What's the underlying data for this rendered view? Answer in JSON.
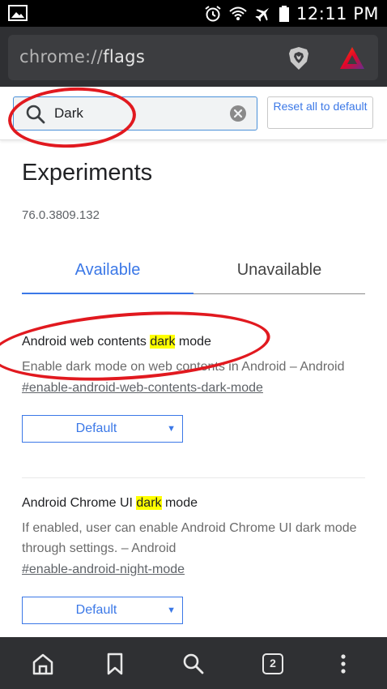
{
  "status_bar": {
    "time": "12:11 PM",
    "left_icon": "gallery-icon",
    "right_icons": [
      "alarm-icon",
      "wifi-icon",
      "airplane-icon",
      "battery-icon"
    ]
  },
  "url_bar": {
    "scheme": "chrome://",
    "path": "flags",
    "icons": [
      "brave-shield-icon",
      "bat-rewards-icon"
    ]
  },
  "search": {
    "value": "Dark",
    "reset_label": "Reset all to default"
  },
  "header": {
    "title": "Experiments",
    "version": "76.0.3809.132"
  },
  "tabs": [
    {
      "label": "Available",
      "active": true
    },
    {
      "label": "Unavailable",
      "active": false
    }
  ],
  "experiments": [
    {
      "title_before": "Android web contents ",
      "title_highlight": "dark",
      "title_after": " mode",
      "description": "Enable dark mode on web contents in Android – Android",
      "link": "#enable-android-web-contents-dark-mode",
      "select_value": "Default"
    },
    {
      "title_before": "Android Chrome UI ",
      "title_highlight": "dark",
      "title_after": " mode",
      "description": "If enabled, user can enable Android Chrome UI dark mode through settings. – Android",
      "link": "#enable-android-night-mode",
      "select_value": "Default"
    }
  ],
  "bottom_bar": {
    "tab_count": "2",
    "icons": [
      "home-icon",
      "bookmark-icon",
      "search-icon",
      "tab-switcher-icon",
      "more-menu-icon"
    ]
  },
  "colors": {
    "accent": "#3b78e7",
    "highlight": "#ffff00",
    "annotation": "#e1191f",
    "toolbar": "#2f3033"
  }
}
